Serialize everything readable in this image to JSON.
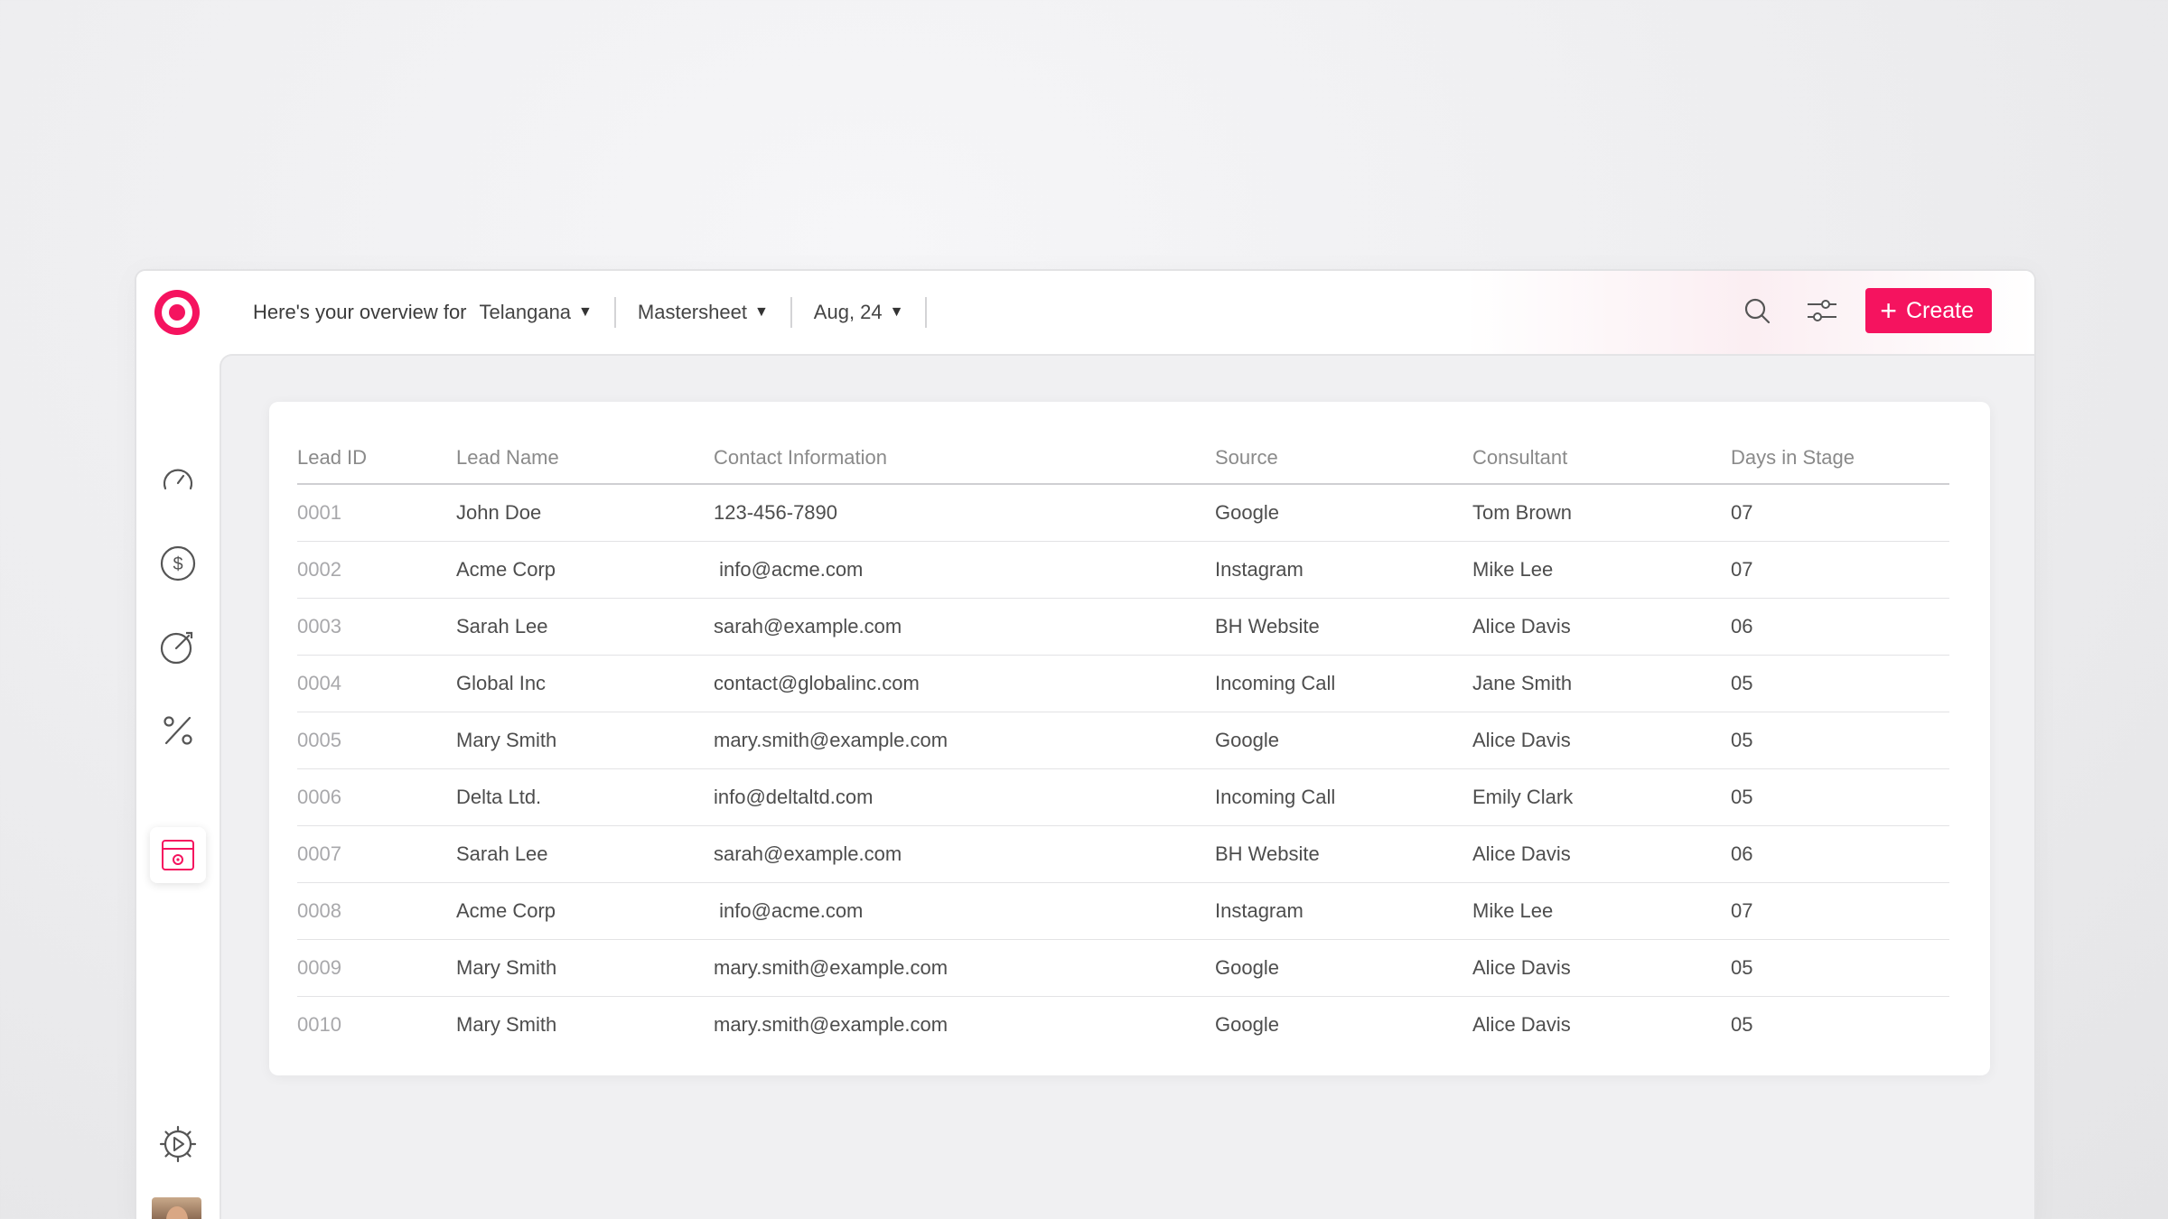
{
  "header": {
    "overview_prefix": "Here's your overview for",
    "region": "Telangana",
    "sheet": "Mastersheet",
    "date": "Aug, 24",
    "create_label": "Create"
  },
  "colors": {
    "accent": "#f5135f"
  },
  "sidebar": {
    "items": [
      {
        "name": "speedometer-icon"
      },
      {
        "name": "dollar-icon"
      },
      {
        "name": "target-icon"
      },
      {
        "name": "percent-icon"
      },
      {
        "name": "calendar-icon",
        "active": true
      }
    ],
    "bottom": [
      {
        "name": "settings-icon"
      },
      {
        "name": "avatar"
      }
    ]
  },
  "table": {
    "columns": [
      "Lead ID",
      "Lead Name",
      "Contact Information",
      "Source",
      "Consultant",
      "Days in Stage"
    ],
    "rows": [
      [
        "0001",
        "John Doe",
        "123-456-7890",
        "Google",
        "Tom Brown",
        "07"
      ],
      [
        "0002",
        "Acme Corp",
        " info@acme.com",
        "Instagram",
        "Mike Lee",
        "07"
      ],
      [
        "0003",
        "Sarah Lee",
        "sarah@example.com",
        "BH Website",
        "Alice Davis",
        "06"
      ],
      [
        "0004",
        "Global Inc",
        "contact@globalinc.com",
        "Incoming Call",
        "Jane Smith",
        "05"
      ],
      [
        "0005",
        "Mary Smith",
        "mary.smith@example.com",
        "Google",
        "Alice Davis",
        "05"
      ],
      [
        "0006",
        "Delta Ltd.",
        "info@deltaltd.com",
        "Incoming Call",
        "Emily Clark",
        "05"
      ],
      [
        "0007",
        "Sarah Lee",
        "sarah@example.com",
        "BH Website",
        "Alice Davis",
        "06"
      ],
      [
        "0008",
        "Acme Corp",
        " info@acme.com",
        "Instagram",
        "Mike Lee",
        "07"
      ],
      [
        "0009",
        "Mary Smith",
        "mary.smith@example.com",
        "Google",
        "Alice Davis",
        "05"
      ],
      [
        "0010",
        "Mary Smith",
        "mary.smith@example.com",
        "Google",
        "Alice Davis",
        "05"
      ]
    ]
  }
}
